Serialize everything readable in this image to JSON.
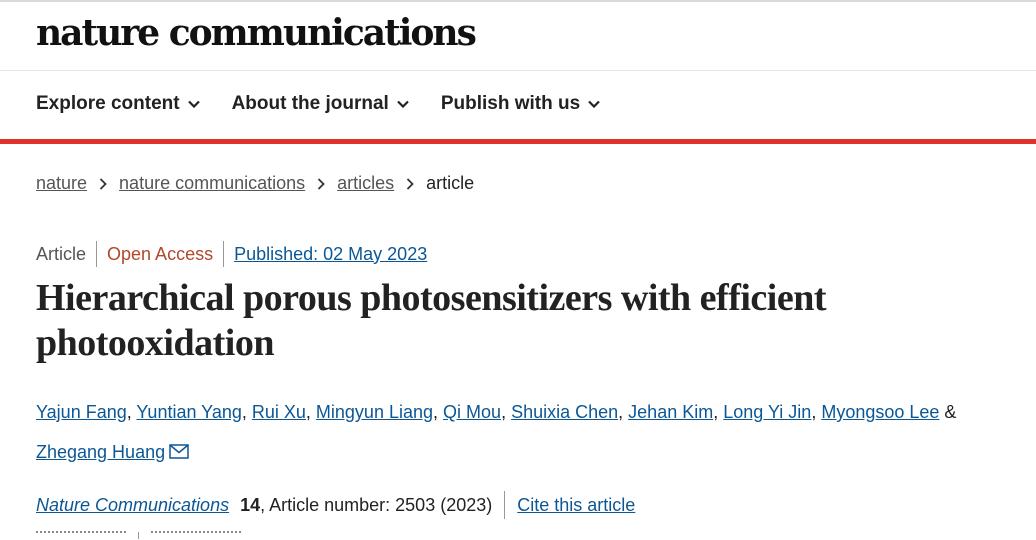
{
  "header": {
    "brand": "nature communications",
    "nav": [
      {
        "label": "Explore content"
      },
      {
        "label": "About the journal"
      },
      {
        "label": "Publish with us"
      }
    ],
    "accent_color": "#e0312a"
  },
  "breadcrumb": {
    "items": [
      "nature",
      "nature communications",
      "articles"
    ],
    "current": "article"
  },
  "article": {
    "type": "Article",
    "access": "Open Access",
    "published": "Published: 02 May 2023",
    "title": "Hierarchical porous photosensitizers with efficient photooxidation",
    "authors": [
      "Yajun Fang",
      "Yuntian Yang",
      "Rui Xu",
      "Mingyun Liang",
      "Qi Mou",
      "Shuixia Chen",
      "Jehan Kim",
      "Long Yi Jin",
      "Myongsoo Lee",
      "Zhegang Huang"
    ],
    "author_separator": ", ",
    "last_separator": " & ",
    "corresponding_icon": "mail-icon",
    "citation": {
      "journal": "Nature Communications",
      "volume": "14",
      "details": ", Article number: 2503 (2023)",
      "cite_link": "Cite this article"
    }
  },
  "colors": {
    "link": "#0b5796",
    "open_access": "#b1482a",
    "text": "#222222"
  }
}
